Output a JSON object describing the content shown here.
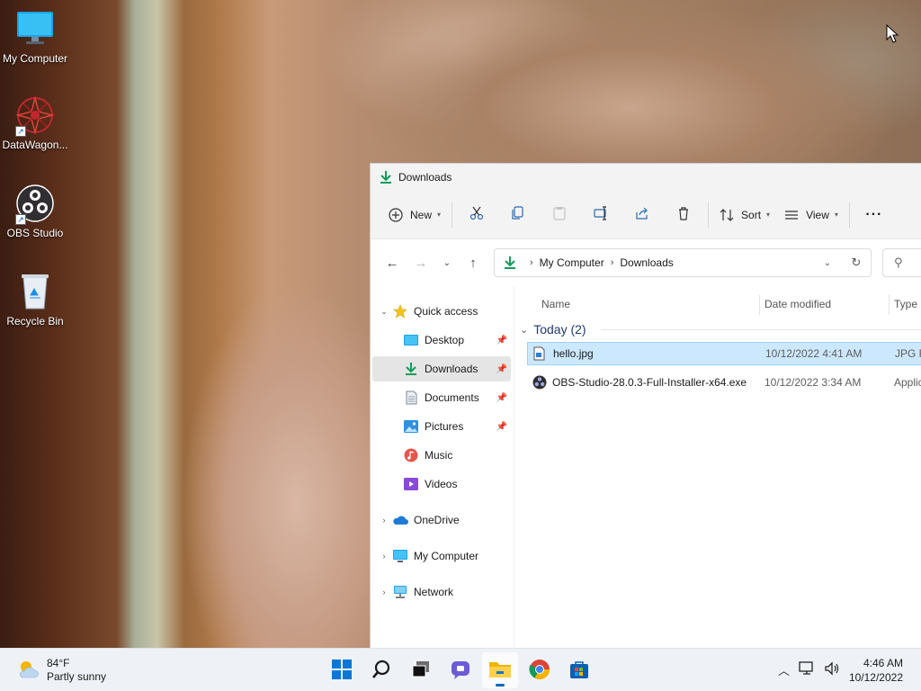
{
  "desktop": {
    "icons": [
      {
        "label": "My Computer",
        "icon": "monitor-icon"
      },
      {
        "label": "DataWagon...",
        "icon": "datawagon-icon"
      },
      {
        "label": "OBS Studio",
        "icon": "obs-icon"
      },
      {
        "label": "Recycle Bin",
        "icon": "recycle-bin-icon"
      }
    ]
  },
  "explorer": {
    "title": "Downloads",
    "commands": {
      "new": "New",
      "sort": "Sort",
      "view": "View"
    },
    "address": {
      "crumbs": [
        "My Computer",
        "Downloads"
      ]
    },
    "nav": {
      "quick_access": "Quick access",
      "items": [
        {
          "label": "Desktop",
          "pinned": true
        },
        {
          "label": "Downloads",
          "pinned": true,
          "selected": true
        },
        {
          "label": "Documents",
          "pinned": true
        },
        {
          "label": "Pictures",
          "pinned": true
        },
        {
          "label": "Music",
          "pinned": false
        },
        {
          "label": "Videos",
          "pinned": false
        }
      ],
      "onedrive": "OneDrive",
      "my_computer": "My Computer",
      "network": "Network"
    },
    "columns": {
      "name": "Name",
      "date": "Date modified",
      "type": "Type"
    },
    "group_label": "Today (2)",
    "files": [
      {
        "name": "hello.jpg",
        "date": "10/12/2022 4:41 AM",
        "type": "JPG Fi",
        "selected": true
      },
      {
        "name": "OBS-Studio-28.0.3-Full-Installer-x64.exe",
        "date": "10/12/2022 3:34 AM",
        "type": "Applic",
        "selected": false
      }
    ]
  },
  "taskbar": {
    "weather": {
      "temp": "84°F",
      "condition": "Partly sunny"
    },
    "clock": {
      "time": "4:46 AM",
      "date": "10/12/2022"
    }
  },
  "colors": {
    "accent": "#0067c0",
    "selection": "#cce8ff",
    "download_green": "#0f9d58"
  }
}
